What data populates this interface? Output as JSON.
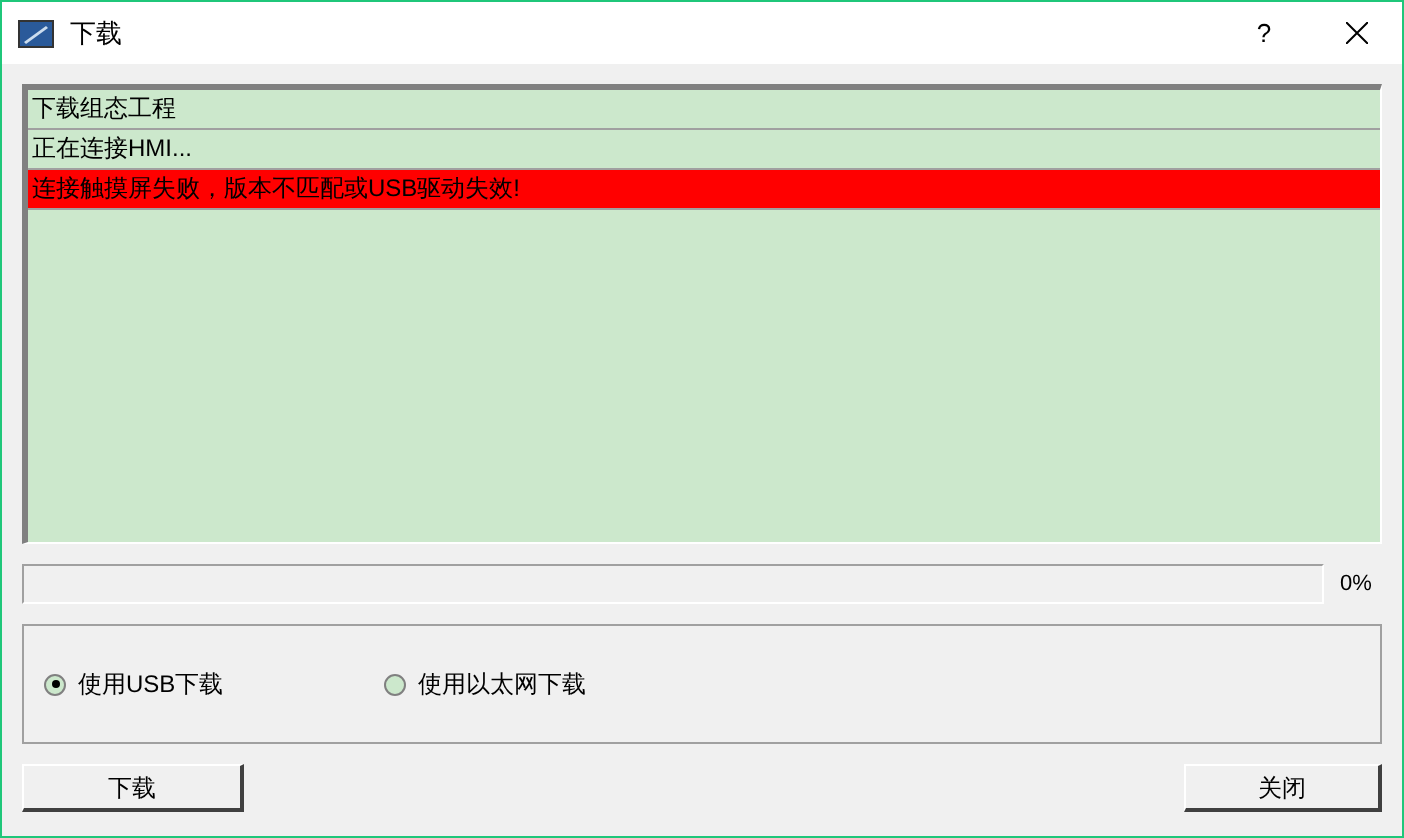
{
  "window": {
    "title": "下载",
    "help": "?"
  },
  "log": [
    {
      "text": "下载组态工程",
      "kind": "normal"
    },
    {
      "text": "正在连接HMI...",
      "kind": "normal"
    },
    {
      "text": "连接触摸屏失败，版本不匹配或USB驱动失效!",
      "kind": "error"
    }
  ],
  "progress": {
    "level": 0,
    "reading": "0%"
  },
  "options": [
    {
      "label": "使用USB下载",
      "selected": true
    },
    {
      "label": "使用以太网下载",
      "selected": false
    }
  ],
  "buttons": [
    "下载",
    "关闭"
  ]
}
